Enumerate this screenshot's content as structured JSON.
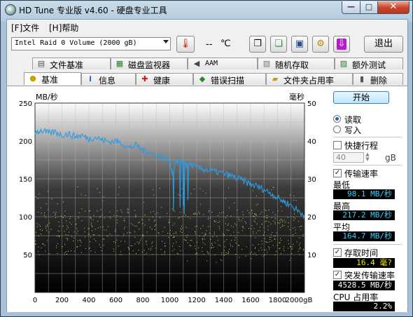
{
  "window": {
    "title": "HD Tune 专业版 v4.60 - 硬盘专业工具"
  },
  "menu": {
    "items": [
      {
        "label": "[F]文件"
      },
      {
        "label": "[H]帮助"
      }
    ]
  },
  "toolbar": {
    "drive": "Intel   Raid 0 Volume (2000 gB)",
    "temperature": "--",
    "temperature_unit": "℃",
    "exit_label": "退出"
  },
  "tabs": {
    "row1": [
      {
        "label": "文件基准",
        "icon": "file-benchmark-icon"
      },
      {
        "label": "磁盘监视器",
        "icon": "disk-monitor-icon"
      },
      {
        "label": "AAM",
        "icon": "speaker-icon"
      },
      {
        "label": "随机存取",
        "icon": "random-access-icon"
      },
      {
        "label": "额外测试",
        "icon": "extra-tests-icon"
      }
    ],
    "row2": [
      {
        "label": "基准",
        "icon": "benchmark-icon"
      },
      {
        "label": "信息",
        "icon": "info-icon"
      },
      {
        "label": "健康",
        "icon": "health-icon"
      },
      {
        "label": "错误扫描",
        "icon": "error-scan-icon"
      },
      {
        "label": "文件夹占用率",
        "icon": "folder-usage-icon"
      },
      {
        "label": "删除",
        "icon": "erase-icon"
      }
    ],
    "active": "基准"
  },
  "side": {
    "start_label": "开始",
    "read_label": "读取",
    "write_label": "写入",
    "mode": "read",
    "short_stroke_label": "快捷行程",
    "short_stroke_value": "40",
    "short_stroke_unit": "gB",
    "transfer_rate_label": "传输速率",
    "min_label": "最低",
    "min_value": "98.1 MB/秒",
    "max_label": "最高",
    "max_value": "217.2 MB/秒",
    "avg_label": "平均",
    "avg_value": "164.7 MB/秒",
    "access_time_label": "存取时间",
    "access_time_value": "16.4 毫?",
    "burst_rate_label": "突发传输速率",
    "burst_rate_value": "4528.5 MB/秒",
    "cpu_label": "CPU 占用率",
    "cpu_value": "2.2%"
  },
  "chart_data": {
    "type": "line",
    "ylabel": "MB/秒",
    "y2label": "毫秒",
    "xlim": [
      0,
      2000
    ],
    "ylim": [
      0,
      250
    ],
    "y2lim": [
      0,
      50
    ],
    "xticks": [
      "0",
      "200",
      "400",
      "600",
      "800",
      "1000",
      "1200",
      "1400",
      "1600",
      "1800",
      "2000gB"
    ],
    "yticks": [
      "50",
      "100",
      "150",
      "200",
      "250"
    ],
    "y2ticks": [
      "10",
      "20",
      "30",
      "40",
      "50"
    ],
    "grid": true,
    "series": [
      {
        "color": "#2e9be0",
        "x": [
          0,
          50,
          100,
          150,
          200,
          250,
          300,
          350,
          400,
          450,
          500,
          550,
          600,
          650,
          700,
          750,
          800,
          850,
          900,
          950,
          1000,
          1020,
          1050,
          1080,
          1100,
          1120,
          1150,
          1200,
          1250,
          1300,
          1350,
          1400,
          1450,
          1500,
          1550,
          1600,
          1650,
          1700,
          1750,
          1800,
          1850,
          1900,
          1950,
          2000
        ],
        "y": [
          212,
          214,
          210,
          212,
          208,
          209,
          206,
          207,
          203,
          205,
          201,
          199,
          200,
          196,
          191,
          194,
          188,
          185,
          181,
          179,
          174,
          158,
          175,
          170,
          172,
          168,
          170,
          165,
          163,
          161,
          159,
          157,
          154,
          151,
          147,
          143,
          140,
          136,
          131,
          125,
          120,
          115,
          108,
          102
        ]
      }
    ],
    "access_time_scatter": {
      "color": "#d6d64a",
      "band_ms": [
        8,
        28
      ],
      "dense_ms": [
        10,
        22
      ],
      "x_range": [
        0,
        2000
      ]
    }
  }
}
